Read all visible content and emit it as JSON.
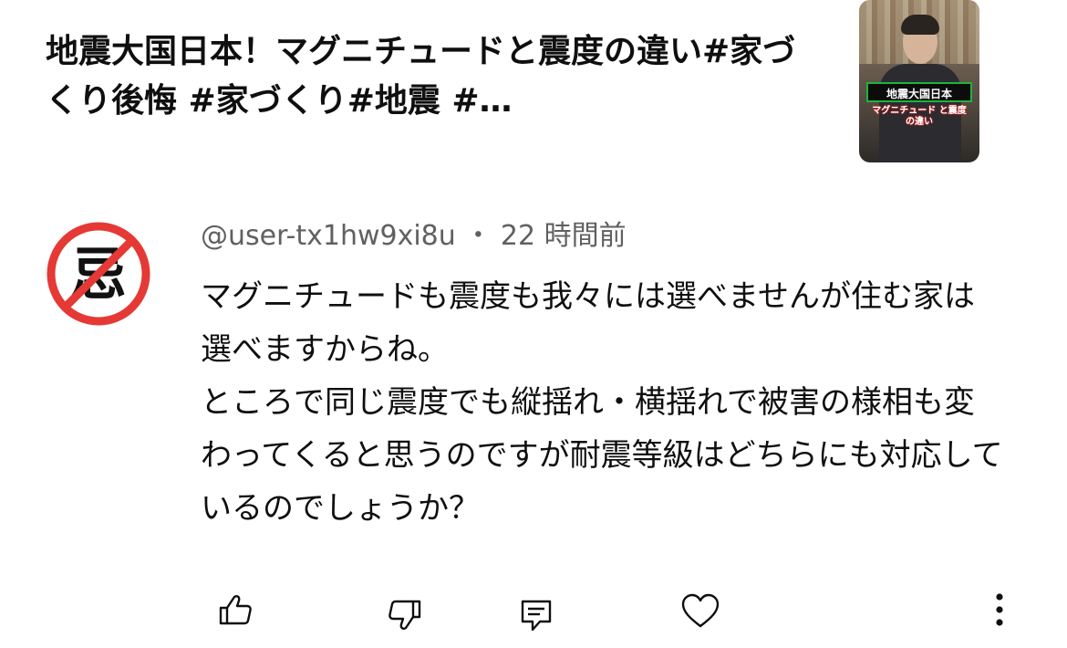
{
  "video": {
    "title": "地震大国日本！マグニチュードと震度の違い#家づくり後悔 #家づくり#地震 #…",
    "thumbnail": {
      "caption_top": "地震大国日本",
      "caption_bottom": "マグニチュード と震度の違い"
    }
  },
  "comment": {
    "author": "@user-tx1hw9xi8u",
    "separator": "・",
    "time": "22 時間前",
    "text": "マグニチュードも震度も我々には選べませんが住む家は選べますからね。\nところで同じ震度でも縦揺れ・横揺れで被害の様相も変わってくると思うのですが耐震等級はどちらにも対応しているのでしょうか？",
    "avatar_glyph": "忌"
  },
  "actions": {
    "like_icon": "thumb-up-icon",
    "dislike_icon": "thumb-down-icon",
    "reply_icon": "comment-icon",
    "heart_icon": "heart-icon",
    "more_icon": "more-vert-icon"
  },
  "colors": {
    "avatar_ring": "#e53935",
    "meta_text": "#606060"
  }
}
